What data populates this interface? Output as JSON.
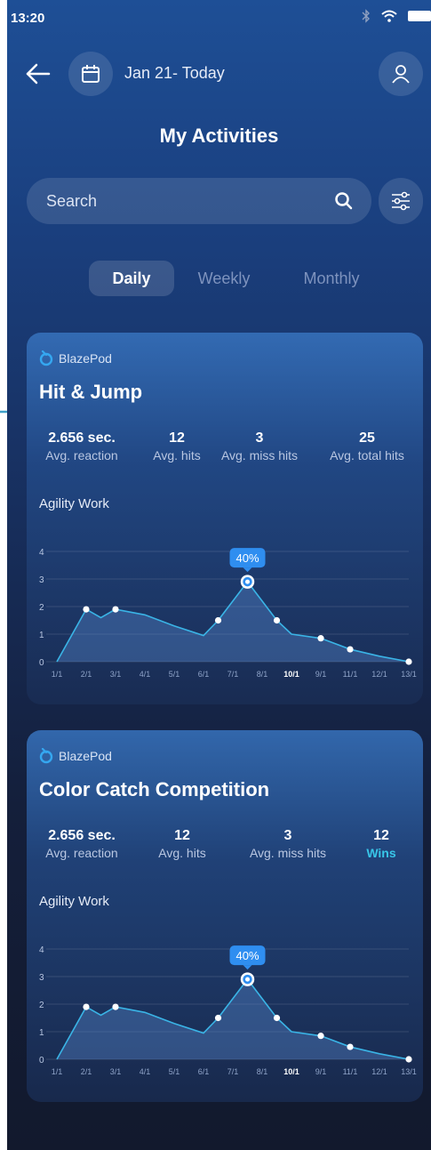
{
  "status_bar": {
    "time": "13:20"
  },
  "header": {
    "date_range": "Jan 21- Today",
    "title": "My Activities"
  },
  "search": {
    "placeholder": "Search"
  },
  "tabs": [
    {
      "label": "Daily",
      "active": true
    },
    {
      "label": "Weekly",
      "active": false
    },
    {
      "label": "Monthly",
      "active": false
    }
  ],
  "cards": [
    {
      "brand": "BlazePod",
      "title": "Hit & Jump",
      "stats": [
        {
          "value": "2.656 sec.",
          "label": "Avg. reaction"
        },
        {
          "value": "12",
          "label": "Avg. hits"
        },
        {
          "value": "3",
          "label": "Avg. miss hits"
        },
        {
          "value": "25",
          "label": "Avg. total hits"
        }
      ],
      "chart_title": "Agility Work",
      "chart_data": {
        "type": "area",
        "categories": [
          "1/1",
          "2/1",
          "3/1",
          "4/1",
          "5/1",
          "6/1",
          "7/1",
          "8/1",
          "10/1",
          "9/1",
          "11/1",
          "12/1",
          "13/1"
        ],
        "x": [
          0,
          1,
          1.5,
          2,
          3,
          4,
          5,
          5.5,
          6.5,
          7.5,
          8,
          9,
          10,
          11,
          12
        ],
        "values": [
          0,
          1.9,
          1.6,
          1.9,
          1.7,
          1.3,
          0.95,
          1.5,
          2.9,
          1.5,
          1.0,
          0.85,
          0.45,
          0.2,
          0
        ],
        "markers": [
          1,
          3,
          7,
          8,
          9,
          11,
          12,
          14
        ],
        "highlight_index": 8,
        "highlight_label": "40%",
        "bold_category": "10/1",
        "y_ticks": [
          "0",
          "1",
          "2",
          "3",
          "4"
        ],
        "ylim": [
          0,
          4
        ]
      }
    },
    {
      "brand": "BlazePod",
      "title": "Color Catch Competition",
      "stats": [
        {
          "value": "2.656 sec.",
          "label": "Avg. reaction"
        },
        {
          "value": "12",
          "label": "Avg. hits"
        },
        {
          "value": "3",
          "label": "Avg. miss hits"
        },
        {
          "value": "12",
          "label": "Wins"
        }
      ],
      "chart_title": "Agility Work",
      "chart_data": {
        "type": "area",
        "categories": [
          "1/1",
          "2/1",
          "3/1",
          "4/1",
          "5/1",
          "6/1",
          "7/1",
          "8/1",
          "10/1",
          "9/1",
          "11/1",
          "12/1",
          "13/1"
        ],
        "x": [
          0,
          1,
          1.5,
          2,
          3,
          4,
          5,
          5.5,
          6.5,
          7.5,
          8,
          9,
          10,
          11,
          12
        ],
        "values": [
          0,
          1.9,
          1.6,
          1.9,
          1.7,
          1.3,
          0.95,
          1.5,
          2.9,
          1.5,
          1.0,
          0.85,
          0.45,
          0.2,
          0
        ],
        "markers": [
          1,
          3,
          7,
          8,
          9,
          11,
          12,
          14
        ],
        "highlight_index": 8,
        "highlight_label": "40%",
        "bold_category": "10/1",
        "y_ticks": [
          "0",
          "1",
          "2",
          "3",
          "4"
        ],
        "ylim": [
          0,
          4
        ]
      }
    }
  ],
  "colors": {
    "accent": "#2f8ef0",
    "line": "#3ab4e6",
    "wins": "#38c6e8",
    "arrow": "#3ea0c8"
  }
}
